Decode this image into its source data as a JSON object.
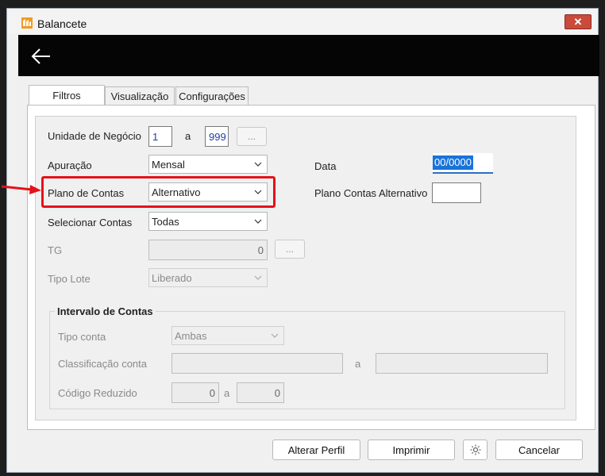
{
  "window": {
    "title": "Balancete",
    "close_glyph": "✕"
  },
  "tabs": [
    {
      "label": "Filtros",
      "active": true
    },
    {
      "label": "Visualização",
      "active": false
    },
    {
      "label": "Configurações",
      "active": false
    }
  ],
  "form": {
    "unidade_negocio": {
      "label": "Unidade de Negócio",
      "from": "1",
      "sep": "a",
      "to": "999",
      "lookup": "..."
    },
    "apuracao": {
      "label": "Apuração",
      "value": "Mensal"
    },
    "plano_contas": {
      "label": "Plano de Contas",
      "value": "Alternativo"
    },
    "selecionar_contas": {
      "label": "Selecionar Contas",
      "value": "Todas"
    },
    "tg": {
      "label": "TG",
      "value": "0",
      "lookup": "..."
    },
    "tipo_lote": {
      "label": "Tipo Lote",
      "value": "Liberado"
    },
    "data": {
      "label": "Data",
      "value": "00/0000"
    },
    "plano_alt": {
      "label": "Plano Contas Alternativo",
      "value": ""
    }
  },
  "intervalo": {
    "title": "Intervalo de Contas",
    "tipo_conta": {
      "label": "Tipo conta",
      "value": "Ambas"
    },
    "classificacao": {
      "label": "Classificação conta",
      "sep": "a",
      "from": "",
      "to": ""
    },
    "codigo_reduzido": {
      "label": "Código Reduzido",
      "from": "0",
      "sep": "a",
      "to": "0"
    }
  },
  "buttons": {
    "alterar_perfil": "Alterar Perfil",
    "imprimir": "Imprimir",
    "cancelar": "Cancelar"
  },
  "colors": {
    "highlight": "#e5121a",
    "header": "#050505",
    "close": "#c94b3c"
  }
}
